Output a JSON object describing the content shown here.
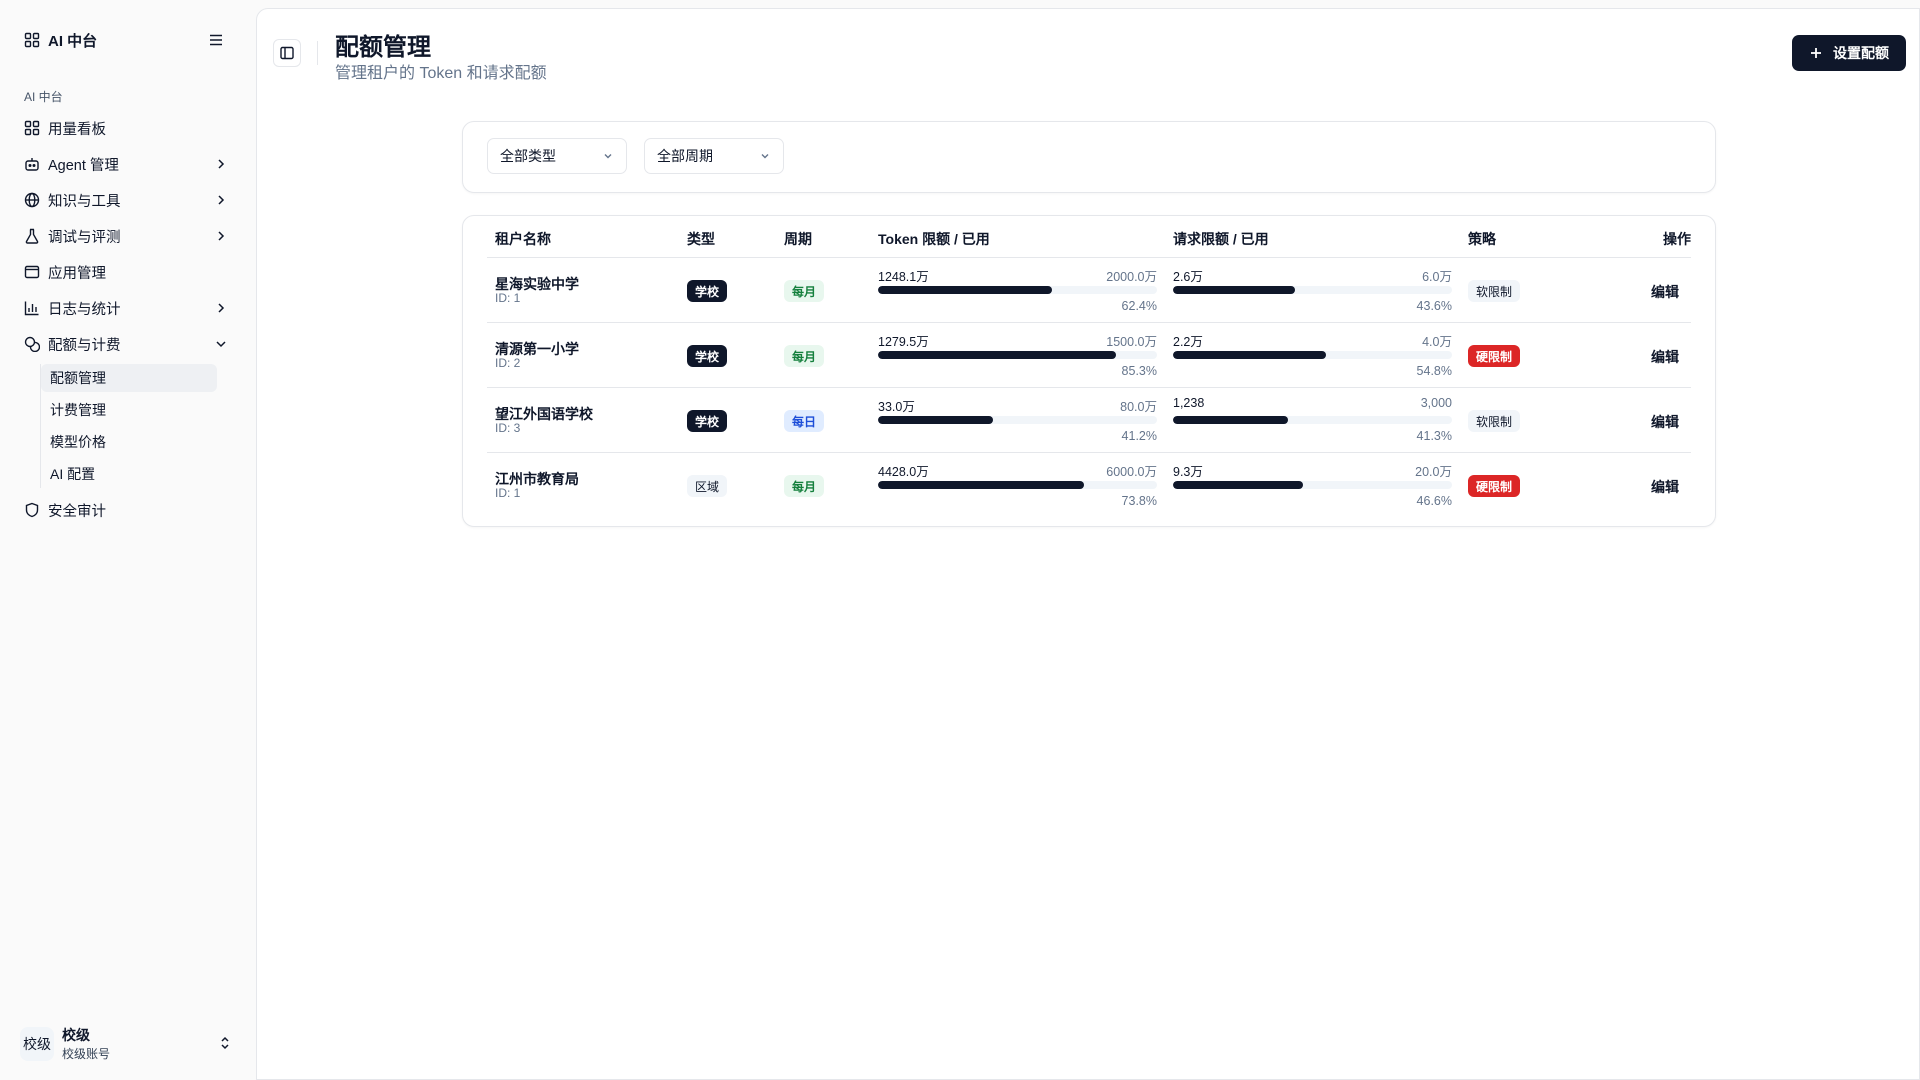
{
  "sidebar": {
    "brand": "AI 中台",
    "group_label": "AI 中台",
    "items": [
      {
        "label": "用量看板",
        "icon": "dashboard-icon",
        "has_chevron": false
      },
      {
        "label": "Agent 管理",
        "icon": "bot-icon",
        "has_chevron": true
      },
      {
        "label": "知识与工具",
        "icon": "globe-icon",
        "has_chevron": true
      },
      {
        "label": "调试与评测",
        "icon": "flask-icon",
        "has_chevron": true
      },
      {
        "label": "应用管理",
        "icon": "app-window-icon",
        "has_chevron": false
      },
      {
        "label": "日志与统计",
        "icon": "bar-chart-icon",
        "has_chevron": true
      },
      {
        "label": "配额与计费",
        "icon": "coins-icon",
        "has_chevron": true,
        "expanded": true
      }
    ],
    "sub_items": [
      {
        "label": "配额管理",
        "active": true
      },
      {
        "label": "计费管理",
        "active": false
      },
      {
        "label": "模型价格",
        "active": false
      },
      {
        "label": "AI 配置",
        "active": false
      }
    ],
    "security": {
      "label": "安全审计",
      "icon": "shield-icon"
    },
    "account": {
      "avatar": "校级",
      "name": "校级",
      "sub": "校级账号"
    }
  },
  "header": {
    "title": "配额管理",
    "subtitle": "管理租户的 Token 和请求配额",
    "primary_button": "设置配额"
  },
  "filters": {
    "type_select": "全部类型",
    "period_select": "全部周期"
  },
  "table": {
    "columns": [
      "租户名称",
      "类型",
      "周期",
      "Token 限额 / 已用",
      "请求限额 / 已用",
      "策略",
      "操作"
    ],
    "rows": [
      {
        "name": "星海实验中学",
        "id": "ID: 1",
        "type": "学校",
        "period": "每月",
        "token_used": "1248.1万",
        "token_limit": "2000.0万",
        "token_pct": "62.4%",
        "token_ratio": 0.624,
        "req_used": "2.6万",
        "req_limit": "6.0万",
        "req_pct": "43.6%",
        "req_ratio": 0.436,
        "policy": "软限制",
        "action": "编辑"
      },
      {
        "name": "清源第一小学",
        "id": "ID: 2",
        "type": "学校",
        "period": "每月",
        "token_used": "1279.5万",
        "token_limit": "1500.0万",
        "token_pct": "85.3%",
        "token_ratio": 0.853,
        "req_used": "2.2万",
        "req_limit": "4.0万",
        "req_pct": "54.8%",
        "req_ratio": 0.548,
        "policy": "硬限制",
        "action": "编辑"
      },
      {
        "name": "望江外国语学校",
        "id": "ID: 3",
        "type": "学校",
        "period": "每日",
        "token_used": "33.0万",
        "token_limit": "80.0万",
        "token_pct": "41.2%",
        "token_ratio": 0.412,
        "req_used": "1,238",
        "req_limit": "3,000",
        "req_pct": "41.3%",
        "req_ratio": 0.413,
        "policy": "软限制",
        "action": "编辑"
      },
      {
        "name": "江州市教育局",
        "id": "ID: 1",
        "type": "区域",
        "period": "每月",
        "token_used": "4428.0万",
        "token_limit": "6000.0万",
        "token_pct": "73.8%",
        "token_ratio": 0.738,
        "req_used": "9.3万",
        "req_limit": "20.0万",
        "req_pct": "46.6%",
        "req_ratio": 0.466,
        "policy": "硬限制",
        "action": "编辑"
      }
    ]
  },
  "colors": {
    "primary": "#0f172a",
    "hard_limit": "#dc2626",
    "monthly": "#15803d",
    "daily": "#1d4ed8"
  }
}
